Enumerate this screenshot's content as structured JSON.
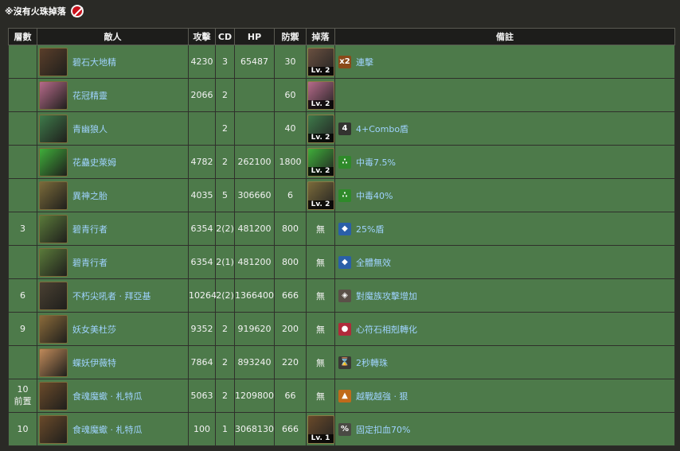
{
  "top_note": "※沒有火珠掉落",
  "headers": [
    "層數",
    "敵人",
    "攻擊",
    "CD",
    "HP",
    "防禦",
    "掉落",
    "備註"
  ],
  "rows": [
    {
      "floor": "",
      "enemy": "碧石大地精",
      "atk": "4230",
      "cd": "3",
      "hp": "65487",
      "def": "30",
      "drop": "Lv. 2",
      "note": "連擊",
      "portrait": "#5a3e2a",
      "drop_color": "#6a5040",
      "note_icon": "#8a4a1a",
      "note_glyph": "x2"
    },
    {
      "floor": "",
      "enemy": "花冠精靈",
      "atk": "2066",
      "cd": "2",
      "hp": "",
      "def": "60",
      "drop": "Lv. 2",
      "note": "",
      "portrait": "#b66a8a",
      "drop_color": "#b66a8a",
      "note_icon": "",
      "note_glyph": ""
    },
    {
      "floor": "",
      "enemy": "青幽狼人",
      "atk": "",
      "cd": "2",
      "hp": "",
      "def": "40",
      "drop": "Lv. 2",
      "note": "4+Combo盾",
      "portrait": "#3e7a4a",
      "drop_color": "#3e7a4a",
      "note_icon": "#333330",
      "note_glyph": "4"
    },
    {
      "floor": "",
      "enemy": "花蠱史萊姆",
      "atk": "4782",
      "cd": "2",
      "hp": "262100",
      "def": "1800",
      "drop": "Lv. 2",
      "note": "中毒7.5%",
      "portrait": "#3fae3a",
      "drop_color": "#3fae3a",
      "note_icon": "#2f8a2a",
      "note_glyph": "∴"
    },
    {
      "floor": "",
      "enemy": "異神之胎",
      "atk": "4035",
      "cd": "5",
      "hp": "306660",
      "def": "6",
      "drop": "Lv. 2",
      "note": "中毒40%",
      "portrait": "#7a6a3a",
      "drop_color": "#7a6a3a",
      "note_icon": "#2f8a2a",
      "note_glyph": "∴"
    },
    {
      "floor": "3",
      "enemy": "碧青行者",
      "atk": "6354",
      "cd": "2(2)",
      "hp": "481200",
      "def": "800",
      "drop": "無",
      "note": "25%盾",
      "portrait": "#5a7a3a",
      "drop_color": "",
      "note_icon": "#2a5fa8",
      "note_glyph": "◆"
    },
    {
      "floor": "",
      "enemy": "碧青行者",
      "atk": "6354",
      "cd": "2(1)",
      "hp": "481200",
      "def": "800",
      "drop": "無",
      "note": "全體無效",
      "portrait": "#5a7a3a",
      "drop_color": "",
      "note_icon": "#2a5fa8",
      "note_glyph": "◆"
    },
    {
      "floor": "6",
      "enemy": "不朽尖吼者 · 拜亞基",
      "atk": "10264",
      "cd": "2(2)",
      "hp": "1366400",
      "def": "666",
      "drop": "無",
      "note": "對魔族攻擊增加",
      "portrait": "#4a4032",
      "drop_color": "",
      "note_icon": "#5a5048",
      "note_glyph": "◈"
    },
    {
      "floor": "9",
      "enemy": "妖女美杜莎",
      "atk": "9352",
      "cd": "2",
      "hp": "919620",
      "def": "200",
      "drop": "無",
      "note": "心符石相剋轉化",
      "portrait": "#8a6a3a",
      "drop_color": "",
      "note_icon": "#b02a3a",
      "note_glyph": "●"
    },
    {
      "floor": "",
      "enemy": "蝶妖伊薇特",
      "atk": "7864",
      "cd": "2",
      "hp": "893240",
      "def": "220",
      "drop": "無",
      "note": "2秒轉珠",
      "portrait": "#c08a5a",
      "drop_color": "",
      "note_icon": "#3a3a36",
      "note_glyph": "⌛"
    },
    {
      "floor": "10\n前置",
      "enemy": "食魂魔蠍 · 札特瓜",
      "atk": "5063",
      "cd": "2",
      "hp": "1209800",
      "def": "66",
      "drop": "無",
      "note": "越戰越強 · 狠",
      "portrait": "#6a4a2a",
      "drop_color": "",
      "note_icon": "#c06a1a",
      "note_glyph": "▲"
    },
    {
      "floor": "10",
      "enemy": "食魂魔蠍 · 札特瓜",
      "atk": "100",
      "cd": "1",
      "hp": "3068130",
      "def": "666",
      "drop": "Lv. 1",
      "note": "固定扣血70%",
      "portrait": "#6a4a2a",
      "drop_color": "#6a4a2a",
      "note_icon": "#4a4a44",
      "note_glyph": "%"
    }
  ]
}
